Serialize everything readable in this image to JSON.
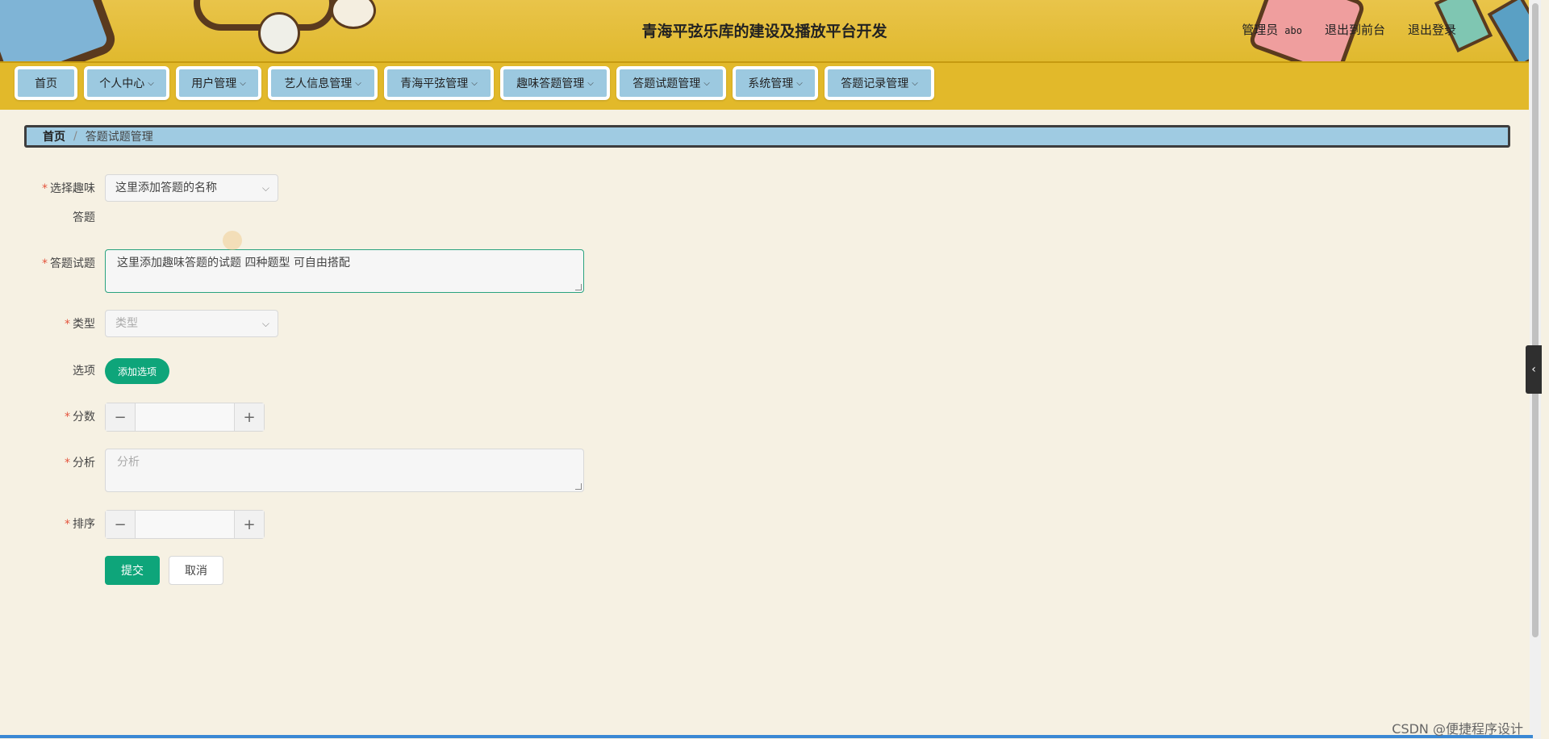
{
  "header": {
    "title": "青海平弦乐库的建设及播放平台开发",
    "user_role": "管理员",
    "user_name": "abo",
    "to_front_label": "退出到前台",
    "logout_label": "退出登录"
  },
  "nav": {
    "items": [
      {
        "label": "首页",
        "has_dropdown": false
      },
      {
        "label": "个人中心",
        "has_dropdown": true
      },
      {
        "label": "用户管理",
        "has_dropdown": true
      },
      {
        "label": "艺人信息管理",
        "has_dropdown": true
      },
      {
        "label": "青海平弦管理",
        "has_dropdown": true
      },
      {
        "label": "趣味答题管理",
        "has_dropdown": true
      },
      {
        "label": "答题试题管理",
        "has_dropdown": true
      },
      {
        "label": "系统管理",
        "has_dropdown": true
      },
      {
        "label": "答题记录管理",
        "has_dropdown": true
      }
    ]
  },
  "breadcrumb": {
    "home": "首页",
    "separator": "/",
    "current": "答题试题管理"
  },
  "form": {
    "quiz": {
      "label_line1": "选择趣味",
      "label_line2": "答题",
      "value": "这里添加答题的名称"
    },
    "question": {
      "label": "答题试题",
      "value": "这里添加趣味答题的试题  四种题型  可自由搭配"
    },
    "type": {
      "label": "类型",
      "placeholder": "类型"
    },
    "options": {
      "label": "选项",
      "add_button": "添加选项"
    },
    "score": {
      "label": "分数",
      "minus": "−",
      "plus": "+"
    },
    "analysis": {
      "label": "分析",
      "placeholder": "分析"
    },
    "order": {
      "label": "排序",
      "minus": "−",
      "plus": "+"
    },
    "submit_label": "提交",
    "cancel_label": "取消",
    "required_mark": "*",
    "dropdown_arrow": "⌵"
  },
  "watermark": "CSDN @便捷程序设计",
  "side_tab_icon": "‹",
  "colors": {
    "header_bg": "#e2b92a",
    "nav_item_bg": "#9cc9e0",
    "primary": "#0ea57a",
    "page_bg": "#f6f1e3"
  }
}
